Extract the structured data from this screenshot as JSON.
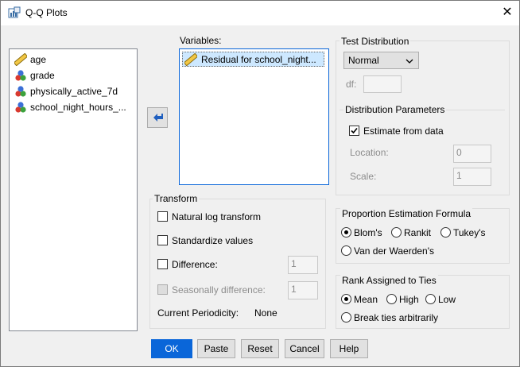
{
  "window": {
    "title": "Q-Q Plots",
    "close_symbol": "✕"
  },
  "source_list": [
    {
      "label": "age",
      "icon": "ruler-icon"
    },
    {
      "label": "grade",
      "icon": "ordinal-icon"
    },
    {
      "label": "physically_active_7d",
      "icon": "ordinal-icon"
    },
    {
      "label": "school_night_hours_...",
      "icon": "ordinal-icon"
    }
  ],
  "variables": {
    "label": "Variables:",
    "items": [
      {
        "label": "Residual for school_night...",
        "icon": "ruler-icon"
      }
    ]
  },
  "move_button": {
    "symbol": "↩"
  },
  "test_distribution": {
    "label": "Test Distribution",
    "selected": "Normal",
    "df_label": "df:",
    "df_value": "",
    "params_label": "Distribution Parameters",
    "estimate_label": "Estimate from data",
    "estimate_checked": true,
    "location_label": "Location:",
    "location_value": "0",
    "scale_label": "Scale:",
    "scale_value": "1"
  },
  "transform": {
    "label": "Transform",
    "natural_log": "Natural log transform",
    "standardize": "Standardize values",
    "difference": "Difference:",
    "difference_value": "1",
    "seasonal": "Seasonally difference:",
    "seasonal_value": "1",
    "periodicity_label": "Current Periodicity:",
    "periodicity_value": "None"
  },
  "proportion": {
    "label": "Proportion Estimation Formula",
    "options": [
      "Blom's",
      "Rankit",
      "Tukey's",
      "Van der Waerden's"
    ],
    "selected": "Blom's"
  },
  "ties": {
    "label": "Rank Assigned to Ties",
    "options": [
      "Mean",
      "High",
      "Low",
      "Break ties arbitrarily"
    ],
    "selected": "Mean"
  },
  "buttons": {
    "ok": "OK",
    "paste": "Paste",
    "reset": "Reset",
    "cancel": "Cancel",
    "help": "Help"
  },
  "colors": {
    "accent": "#0a66d9",
    "selection": "#cde8ff"
  }
}
